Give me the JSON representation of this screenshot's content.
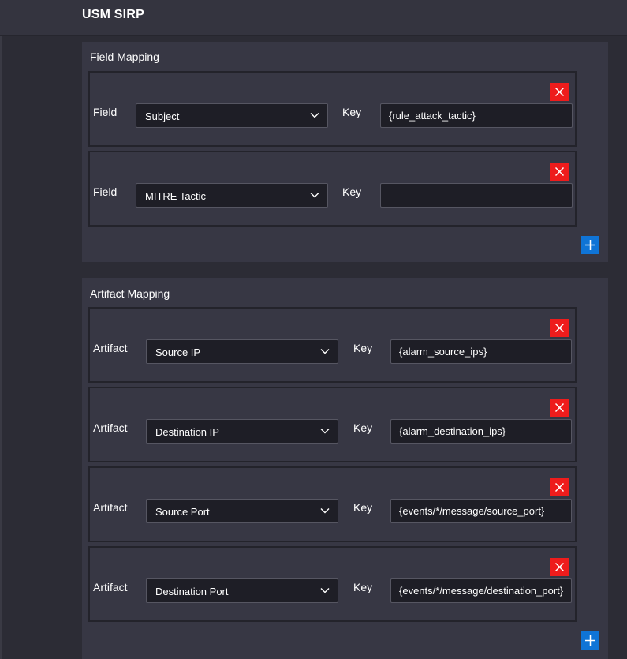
{
  "app": {
    "title": "USM SIRP"
  },
  "field_mapping": {
    "title": "Field Mapping",
    "rows": [
      {
        "label": "Field",
        "select_value": "Subject",
        "key_label": "Key",
        "key_value": "{rule_attack_tactic}"
      },
      {
        "label": "Field",
        "select_value": "MITRE Tactic",
        "key_label": "Key",
        "key_value": ""
      }
    ]
  },
  "artifact_mapping": {
    "title": "Artifact Mapping",
    "rows": [
      {
        "label": "Artifact",
        "select_value": "Source IP",
        "key_label": "Key",
        "key_value": "{alarm_source_ips}"
      },
      {
        "label": "Artifact",
        "select_value": "Destination IP",
        "key_label": "Key",
        "key_value": "{alarm_destination_ips}"
      },
      {
        "label": "Artifact",
        "select_value": "Source Port",
        "key_label": "Key",
        "key_value": "{events/*/message/source_port}"
      },
      {
        "label": "Artifact",
        "select_value": "Destination Port",
        "key_label": "Key",
        "key_value": "{events/*/message/destination_port}"
      }
    ]
  },
  "icons": {
    "delete": "close-icon",
    "add": "plus-icon",
    "dropdown": "chevron-down-icon"
  },
  "colors": {
    "delete": "#ee1c1c",
    "add": "#0f74d6",
    "background": "#2c2c35",
    "panel": "#373744"
  }
}
